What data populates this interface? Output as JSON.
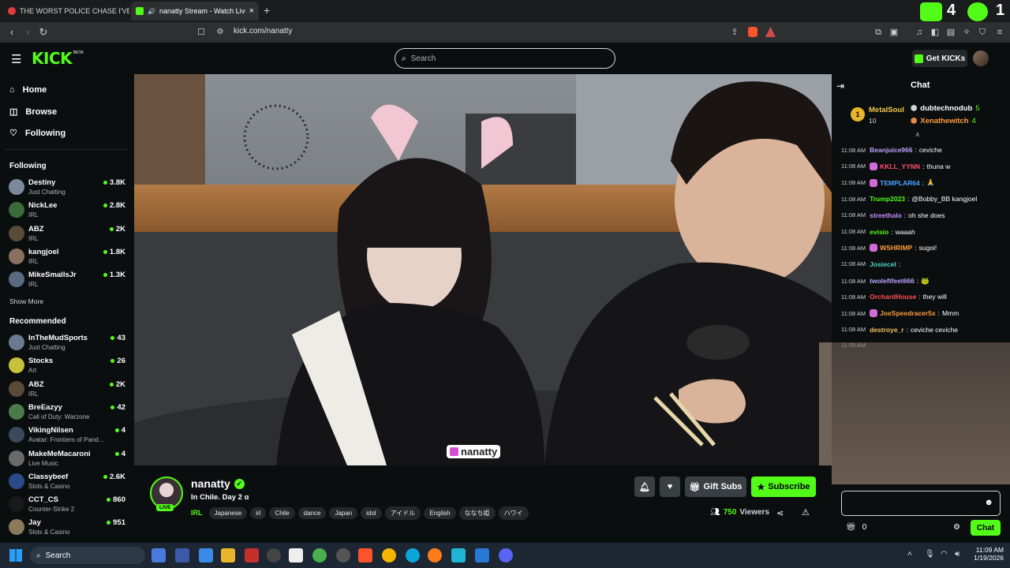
{
  "browser": {
    "tabs": [
      {
        "title": "THE WORST POLICE CHASE I'VE EVER"
      },
      {
        "title": "nanatty Stream - Watch Live o",
        "close": "×"
      }
    ],
    "new_tab": "+",
    "url": "kick.com/nanatty",
    "ext_counts": {
      "a": "4",
      "b": "1"
    }
  },
  "header": {
    "logo": "KICK",
    "logo_beta": "BETA",
    "search_placeholder": "Search",
    "get_kicks": "Get KICKs"
  },
  "sidebar": {
    "nav": [
      {
        "label": "Home"
      },
      {
        "label": "Browse"
      },
      {
        "label": "Following"
      }
    ],
    "following_title": "Following",
    "following": [
      {
        "name": "Destiny",
        "category": "Just Chatting",
        "viewers": "3.8K",
        "color": "#7a8a9a"
      },
      {
        "name": "NickLee",
        "category": "IRL",
        "viewers": "2.8K",
        "color": "#3a6b3a"
      },
      {
        "name": "ABZ",
        "category": "IRL",
        "viewers": "2K",
        "color": "#5a4a3a"
      },
      {
        "name": "kangjoel",
        "category": "IRL",
        "viewers": "1.8K",
        "color": "#8a7060"
      },
      {
        "name": "MikeSmallsJr",
        "category": "IRL",
        "viewers": "1.3K",
        "color": "#5a6a80"
      }
    ],
    "show_more": "Show More",
    "recommended_title": "Recommended",
    "recommended": [
      {
        "name": "InTheMudSports",
        "category": "Just Chatting",
        "viewers": "43",
        "color": "#6a7a90"
      },
      {
        "name": "Stocks",
        "category": "Art",
        "viewers": "26",
        "color": "#c8c23a"
      },
      {
        "name": "ABZ",
        "category": "IRL",
        "viewers": "2K",
        "color": "#5a4a3a"
      },
      {
        "name": "BreEazyy",
        "category": "Call of Duty: Warzone",
        "viewers": "42",
        "color": "#4a7a4a"
      },
      {
        "name": "VikingNilsen",
        "category": "Avatar: Frontiers of Pand...",
        "viewers": "4",
        "color": "#3a4a5a"
      },
      {
        "name": "MakeMeMacaroni",
        "category": "Live Music",
        "viewers": "4",
        "color": "#6a6a6a"
      },
      {
        "name": "Classybeef",
        "category": "Slots & Casino",
        "viewers": "2.6K",
        "color": "#2a4a8a"
      },
      {
        "name": "CCT_CS",
        "category": "Counter-Strike 2",
        "viewers": "860",
        "color": "#1a1a1a"
      },
      {
        "name": "Jay",
        "category": "Slots & Casino",
        "viewers": "951",
        "color": "#8a7a5a"
      }
    ]
  },
  "video": {
    "watermark": "nanatty"
  },
  "stream": {
    "streamer": "nanatty",
    "live_badge": "LIVE",
    "title": "In Chile. Day 2 ɑ",
    "category": "IRL",
    "tags": [
      "Japanese",
      "irl",
      "Chile",
      "dance",
      "Japan",
      "idol",
      "アイドル",
      "English",
      "ななち姫",
      "ハワイ"
    ],
    "gift_subs": "Gift Subs",
    "subscribe": "Subscribe",
    "viewers": "750",
    "viewers_label": "Viewers"
  },
  "chat": {
    "title": "Chat",
    "top_gifters": [
      {
        "rank": "1",
        "name": "MetalSoul",
        "count": "10"
      },
      {
        "name": "dubtechnodub",
        "count": "5"
      },
      {
        "name": "Xenathewitch",
        "count": "4"
      }
    ],
    "messages": [
      {
        "time": "11:08 AM",
        "user": "Beanjuice966",
        "text": "ceviche",
        "color": "#b9a3ff",
        "badge": ""
      },
      {
        "time": "11:08 AM",
        "user": "KKLL_YYNN",
        "text": "thuna w",
        "color": "#ff4f6b",
        "badge": "#d36ad9"
      },
      {
        "time": "11:08 AM",
        "user": "TEMPLAR64",
        "text": "🙏",
        "color": "#4aa3ff",
        "badge": "#d36ad9"
      },
      {
        "time": "11:08 AM",
        "user": "Trump2023",
        "text": "@Bobby_BB kangjoel",
        "color": "#53fc18",
        "badge": ""
      },
      {
        "time": "11:08 AM",
        "user": "streethalo",
        "text": "oh she does",
        "color": "#c48fff",
        "badge": ""
      },
      {
        "time": "11:08 AM",
        "user": "evisio",
        "text": "waaah",
        "color": "#53fc18",
        "badge": ""
      },
      {
        "time": "11:08 AM",
        "user": "WSHRIMP",
        "text": "sugoi!",
        "color": "#ff9b3d",
        "badge": "#d36ad9"
      },
      {
        "time": "11:08 AM",
        "user": "Josiecel",
        "text": "",
        "color": "#4fd3c4",
        "badge": ""
      },
      {
        "time": "11:08 AM",
        "user": "twoleftfeet666",
        "text": "🐸",
        "color": "#b9a3ff",
        "badge": ""
      },
      {
        "time": "11:08 AM",
        "user": "OrchardHouse",
        "text": "they will",
        "color": "#ff4f4f",
        "badge": ""
      },
      {
        "time": "11:08 AM",
        "user": "JoeSpeedracer5x",
        "text": "Mmm",
        "color": "#ff9b3d",
        "badge": "#d36ad9"
      },
      {
        "time": "11:08 AM",
        "user": "destroye_r",
        "text": "ceviche ceviche",
        "color": "#f0c060",
        "badge": ""
      },
      {
        "time": "11:09 AM",
        "user": "",
        "text": "",
        "color": "#9aa0a6",
        "badge": ""
      }
    ],
    "points": "0",
    "send_label": "Chat"
  },
  "taskbar": {
    "search": "Search",
    "time": "11:09 AM",
    "date": "1/19/2026"
  }
}
